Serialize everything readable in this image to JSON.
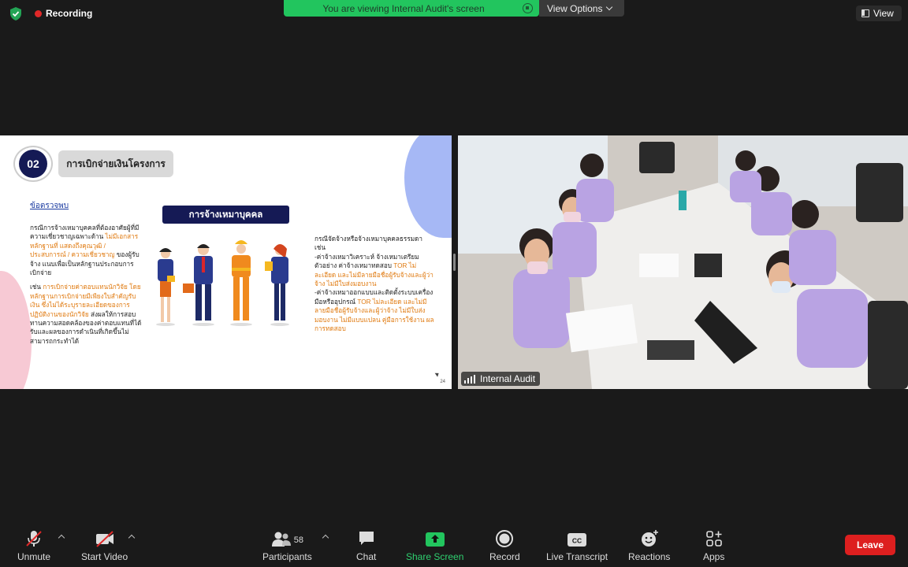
{
  "topbar": {
    "recording_label": "Recording",
    "viewing_banner": "You are viewing Internal Audit's screen",
    "view_options_label": "View Options",
    "view_label": "View"
  },
  "slide": {
    "number": "02",
    "title": "การเบิกจ่ายเงินโครงการ",
    "findings_label": "ข้อตรวจพบ",
    "hire_heading": "การจ้างเหมาบุคคล",
    "col1_p1_plain": "กรณีการจ้างเหมาบุคคลที่ต้องอาศัยผู้ที่มีความเชี่ยวชาญเฉพาะด้าน ",
    "col1_p1_orange": "ไม่มีเอกสารหลักฐานที่ แสดงถึงคุณวุฒิ / ประสบการณ์ / ความเชี่ยวชาญ",
    "col1_p1_tail": " ของผู้รับจ้าง แนบเพื่อเป็นหลักฐานประกอบการเบิกจ่าย",
    "col1_p2_plain": "เช่น ",
    "col1_p2_orange": "การเบิกจ่ายค่าตอบแทนนักวิจัย โดยหลักฐานการเบิกจ่ายมีเพียงใบสำคัญรับเงิน ซึ่งไม่ได้ระบุรายละเอียดของการปฏิบัติงานของนักวิจัย",
    "col1_p2_tail": " ส่งผลให้การสอบทานความสอดคล้องของค่าตอบแทนที่ได้รับและผลของการดำเนินที่เกิดขึ้นไม่สามารถกระทำได้",
    "col3_intro": "กรณีจัดจ้างหรือจ้างเหมาบุคคลธรรมดา เช่น",
    "col3_b1_plain": "-ค่าจ้างเหมาวิเคราะห์ จ้างเหมาเตรียมตัวอย่าง ค่าจ้างเหมาทดสอบ ",
    "col3_b1_orange": "TOR ไม่ละเอียด และไม่มีลายมือชื่อผู้รับจ้างและผู้ว่าจ้าง ไม่มีใบส่งมอบงาน",
    "col3_b2_plain": "-ค่าจ้างเหมาออกแบบและติดตั้งระบบเครื่องมือหรืออุปกรณ์ ",
    "col3_b2_orange": "TOR ไม่ละเอียด และไม่มีลายมือชื่อผู้รับจ้างและผู้ว่าจ้าง ไม่มีใบส่งมอบงาน ไม่มีแบบแปลน คู่มือการใช้งาน ผลการทดสอบ",
    "page_number": "24"
  },
  "video": {
    "participant_name": "Internal Audit"
  },
  "toolbar": {
    "unmute": "Unmute",
    "start_video": "Start Video",
    "participants": "Participants",
    "participants_count": "58",
    "chat": "Chat",
    "share_screen": "Share Screen",
    "record": "Record",
    "live_transcript": "Live Transcript",
    "reactions": "Reactions",
    "apps": "Apps",
    "leave": "Leave"
  },
  "colors": {
    "share_green": "#22c55e",
    "leave_red": "#dd1f1f",
    "slide_navy": "#151a55",
    "slide_orange": "#e07a10"
  }
}
